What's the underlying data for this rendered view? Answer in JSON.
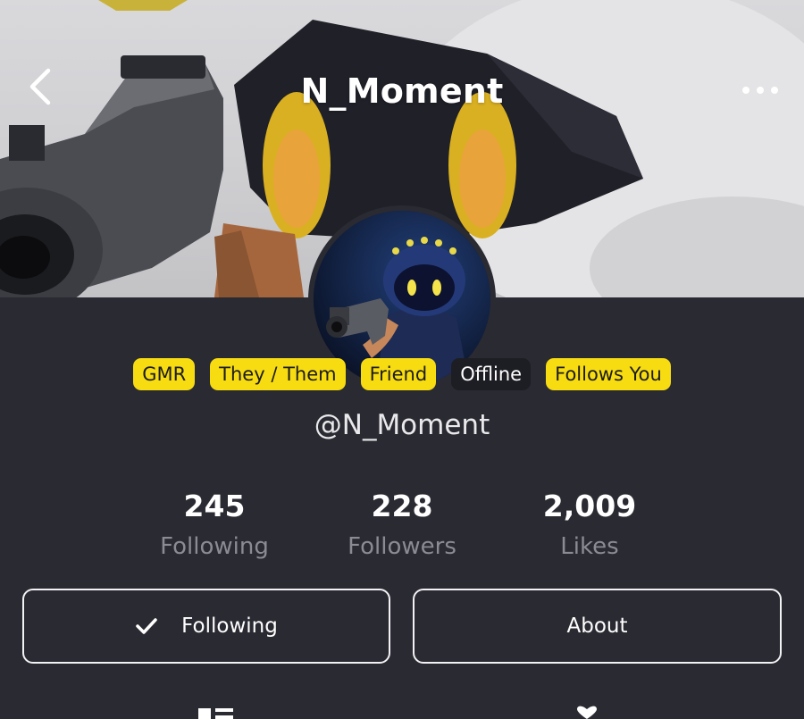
{
  "header": {
    "title": "N_Moment",
    "back_icon": "chevron-left-icon",
    "more_icon": "more-horizontal-icon"
  },
  "profile": {
    "handle": "@N_Moment",
    "badges": [
      {
        "label": "GMR",
        "style": "yellow"
      },
      {
        "label": "They / Them",
        "style": "yellow"
      },
      {
        "label": "Friend",
        "style": "yellow"
      },
      {
        "label": "Offline",
        "style": "dark"
      },
      {
        "label": "Follows You",
        "style": "yellow"
      }
    ],
    "stats": [
      {
        "value": "245",
        "label": "Following"
      },
      {
        "value": "228",
        "label": "Followers"
      },
      {
        "value": "2,009",
        "label": "Likes"
      }
    ]
  },
  "actions": {
    "following_label": "Following",
    "about_label": "About",
    "following_icon": "checkmark-icon"
  },
  "tabs": {
    "icons": [
      "grid-list-icon",
      "heart-icon"
    ]
  },
  "colors": {
    "background": "#2a2a32",
    "badge_yellow": "#f7dc12",
    "badge_dark": "#1d1d24",
    "muted_text": "#8b8b93"
  }
}
